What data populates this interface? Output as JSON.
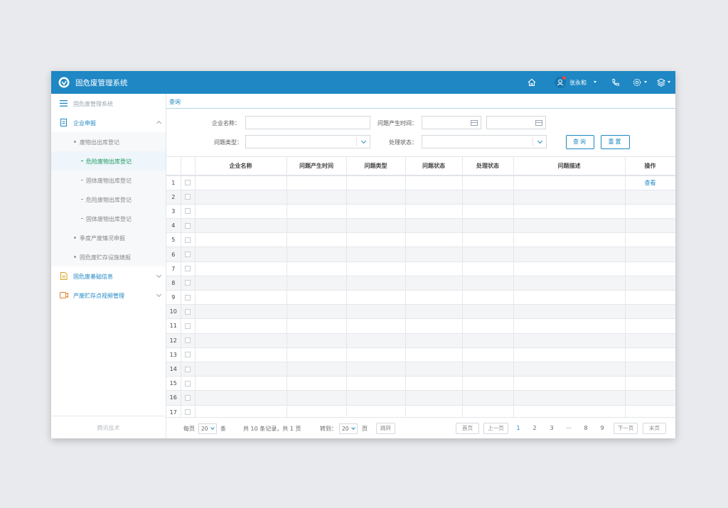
{
  "app": {
    "title": "固危废管理系统",
    "username": "张永和"
  },
  "icons": {
    "logo": "shield-logo-icon",
    "home": "home-icon",
    "user": "user-icon",
    "phone": "phone-icon",
    "settings": "gear-icon",
    "layers": "layers-icon"
  },
  "colors": {
    "brand": "#1e87c4",
    "active_text": "#1a9a5c",
    "menu_orange": "#e2812e"
  },
  "sidebar": {
    "header": "固危废管理系统",
    "groups": [
      {
        "label": "企业申报",
        "expanded": true
      },
      {
        "label": "固危废基础信息",
        "expanded": false
      },
      {
        "label": "产废贮存点视频管理",
        "expanded": false
      }
    ],
    "sub1": "废物出出库登记",
    "sub1_items": [
      "危险废物出库登记",
      "固体废物出库登记",
      "危险废物出库登记",
      "固体废物出库登记"
    ],
    "sub2": "季度产废情况申报",
    "sub3": "固危废贮存设施填报",
    "footer": "腾讯技术"
  },
  "main": {
    "tab": "查询",
    "filters": {
      "company_label": "企业名称：",
      "time_label": "问题产生时间：",
      "type_label": "问题类型：",
      "status_label": "处理状态："
    },
    "buttons": {
      "query": "查询",
      "reset": "重置"
    },
    "table": {
      "headers": [
        "企业名称",
        "问题产生时间",
        "问题类型",
        "问题状态",
        "处理状态",
        "问题描述",
        "操作"
      ],
      "row_numbers": [
        "1",
        "2",
        "3",
        "4",
        "5",
        "6",
        "7",
        "8",
        "9",
        "10",
        "11",
        "12",
        "13",
        "14",
        "15",
        "16",
        "17"
      ],
      "row1_action": "查看"
    },
    "pager": {
      "per_page_prefix": "每页",
      "per_page_value": "20",
      "per_page_suffix": "条",
      "summary": "共 10 条记录，共 1 页",
      "goto_label": "转到：",
      "goto_value": "20",
      "goto_suffix": "页",
      "jump": "跳转",
      "first": "首页",
      "prev": "上一页",
      "pages": [
        "1",
        "2",
        "3",
        "…",
        "8",
        "9"
      ],
      "current_page": "1",
      "next": "下一页",
      "last": "末页"
    }
  }
}
